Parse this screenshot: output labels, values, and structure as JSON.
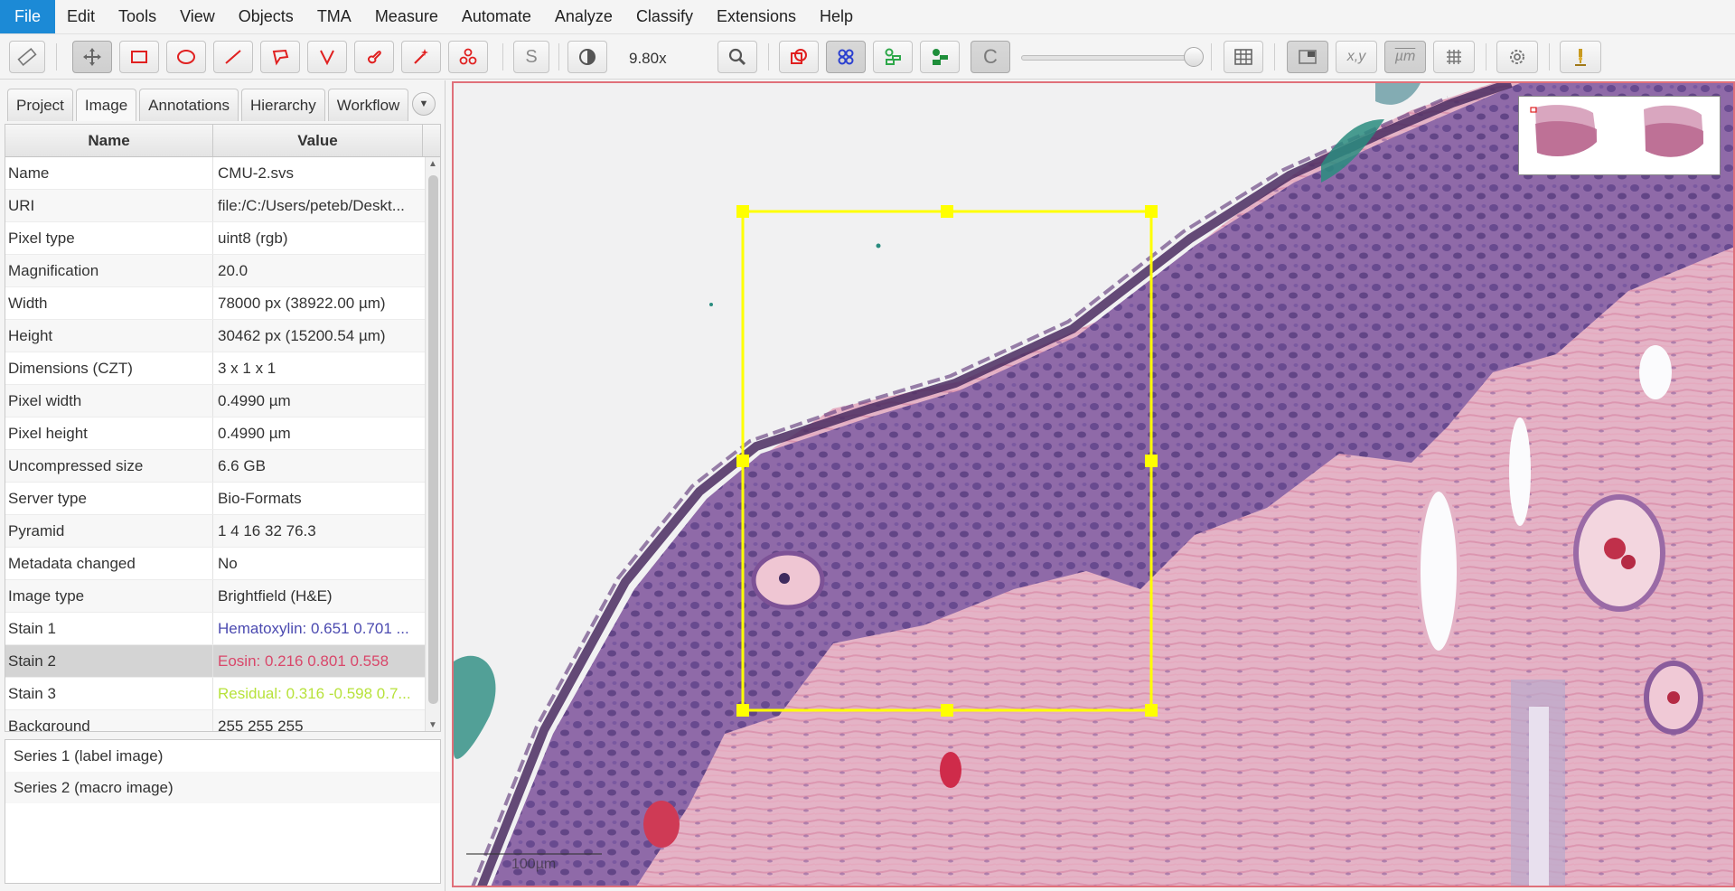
{
  "menu": [
    "File",
    "Edit",
    "Tools",
    "View",
    "Objects",
    "TMA",
    "Measure",
    "Automate",
    "Analyze",
    "Classify",
    "Extensions",
    "Help"
  ],
  "toolbar": {
    "zoom": "9.80x",
    "coord_label": "x,y",
    "micron_label": "µm",
    "select_label": "S",
    "c_label": "C",
    "opacity_level": 1.0
  },
  "tabs": [
    "Project",
    "Image",
    "Annotations",
    "Hierarchy",
    "Workflow"
  ],
  "table": {
    "headers": [
      "Name",
      "Value"
    ],
    "rows": [
      {
        "name": "Name",
        "value": "CMU-2.svs",
        "color": "#333333"
      },
      {
        "name": "URI",
        "value": "file:/C:/Users/peteb/Deskt...",
        "color": "#333333"
      },
      {
        "name": "Pixel type",
        "value": "uint8 (rgb)",
        "color": "#333333"
      },
      {
        "name": "Magnification",
        "value": "20.0",
        "color": "#333333"
      },
      {
        "name": "Width",
        "value": "78000 px (38922.00 µm)",
        "color": "#333333"
      },
      {
        "name": "Height",
        "value": "30462 px (15200.54 µm)",
        "color": "#333333"
      },
      {
        "name": "Dimensions (CZT)",
        "value": "3 x 1 x 1",
        "color": "#333333"
      },
      {
        "name": "Pixel width",
        "value": "0.4990 µm",
        "color": "#333333"
      },
      {
        "name": "Pixel height",
        "value": "0.4990 µm",
        "color": "#333333"
      },
      {
        "name": "Uncompressed size",
        "value": "6.6 GB",
        "color": "#333333"
      },
      {
        "name": "Server type",
        "value": "Bio-Formats",
        "color": "#333333"
      },
      {
        "name": "Pyramid",
        "value": "1 4 16 32 76.3",
        "color": "#333333"
      },
      {
        "name": "Metadata changed",
        "value": "No",
        "color": "#333333"
      },
      {
        "name": "Image type",
        "value": "Brightfield (H&E)",
        "color": "#333333"
      },
      {
        "name": "Stain 1",
        "value": "Hematoxylin: 0.651 0.701 ...",
        "color": "#4b4ab0"
      },
      {
        "name": "Stain 2",
        "value": "Eosin: 0.216 0.801 0.558",
        "color": "#d9476a"
      },
      {
        "name": "Stain 3",
        "value": "Residual: 0.316 -0.598 0.7...",
        "color": "#b7e23a"
      },
      {
        "name": "Background",
        "value": "255 255 255",
        "color": "#333333"
      }
    ],
    "selected_row": 15
  },
  "series": [
    "Series 1 (label image)",
    "Series 2 (macro image)"
  ],
  "viewer": {
    "scalebar_label": "100µm",
    "roi_color": "#ffff00",
    "border_color": "#e0707a"
  }
}
